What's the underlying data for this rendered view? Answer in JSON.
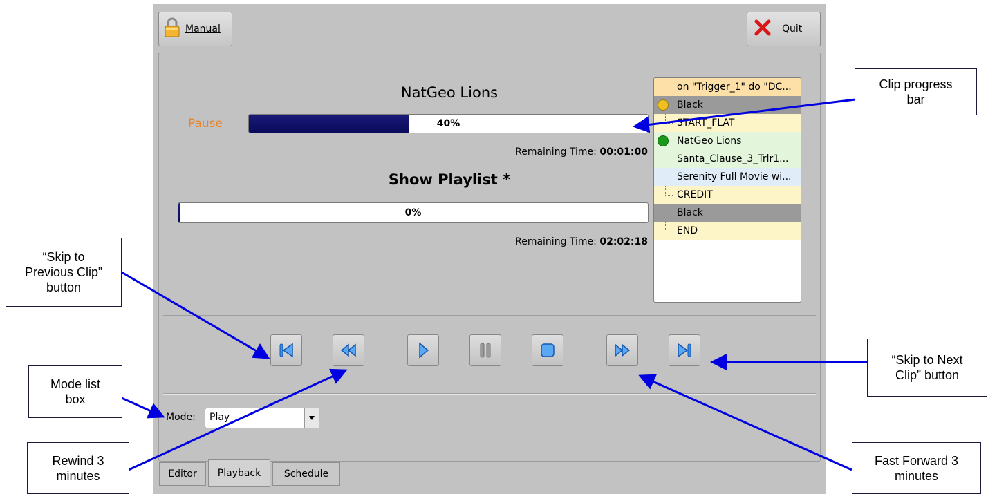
{
  "toolbar": {
    "manual_label": "Manual",
    "quit_label": "Quit"
  },
  "clip": {
    "title": "NatGeo Lions",
    "status": "Pause",
    "progress_label": "40%",
    "progress": 0.4,
    "remaining_label": "Remaining Time:",
    "remaining_value": "00:01:00"
  },
  "show": {
    "title": "Show Playlist *",
    "progress_label": "0%",
    "progress": 0.0,
    "remaining_label": "Remaining Time:",
    "remaining_value": "02:02:18"
  },
  "playlist": {
    "items": [
      {
        "label": "on \"Trigger_1\" do \"DC...",
        "bg": "#fde0a8"
      },
      {
        "label": "Black",
        "bg": "#9a9a9a",
        "dot": "#f0c020"
      },
      {
        "label": "START_FLAT",
        "bg": "#fdf5c8",
        "branch": true
      },
      {
        "label": "NatGeo Lions",
        "bg": "#e3f6dc",
        "dot": "#1a9a1a"
      },
      {
        "label": "Santa_Clause_3_Trlr1...",
        "bg": "#e3f6dc"
      },
      {
        "label": "Serenity Full Movie wi...",
        "bg": "#e0ecf8"
      },
      {
        "label": "CREDIT",
        "bg": "#fdf5c8",
        "branch": true
      },
      {
        "label": "Black",
        "bg": "#9a9a9a"
      },
      {
        "label": "END",
        "bg": "#fdf5c8",
        "branch": true
      }
    ]
  },
  "transport": {
    "icons": [
      "skip-previous-icon",
      "rewind-icon",
      "play-icon",
      "pause-icon",
      "stop-icon",
      "fast-forward-icon",
      "skip-next-icon"
    ]
  },
  "mode": {
    "label": "Mode:",
    "value": "Play"
  },
  "tabs": [
    {
      "label": "Editor"
    },
    {
      "label": "Playback",
      "active": true
    },
    {
      "label": "Schedule"
    }
  ],
  "callouts": {
    "clip_progress": [
      "Clip progress",
      "bar"
    ],
    "skip_previous": [
      "“Skip to",
      "Previous Clip”",
      "button"
    ],
    "skip_next": [
      "“Skip to Next",
      "Clip” button"
    ],
    "mode_list": [
      "Mode list",
      "box"
    ],
    "rewind": [
      "Rewind 3",
      "minutes"
    ],
    "fast_forward": [
      "Fast Forward 3",
      "minutes"
    ]
  },
  "colors": {
    "accent_status": "#e8832a",
    "progress_fill": "#10106a",
    "arrow": "#0000e0"
  }
}
